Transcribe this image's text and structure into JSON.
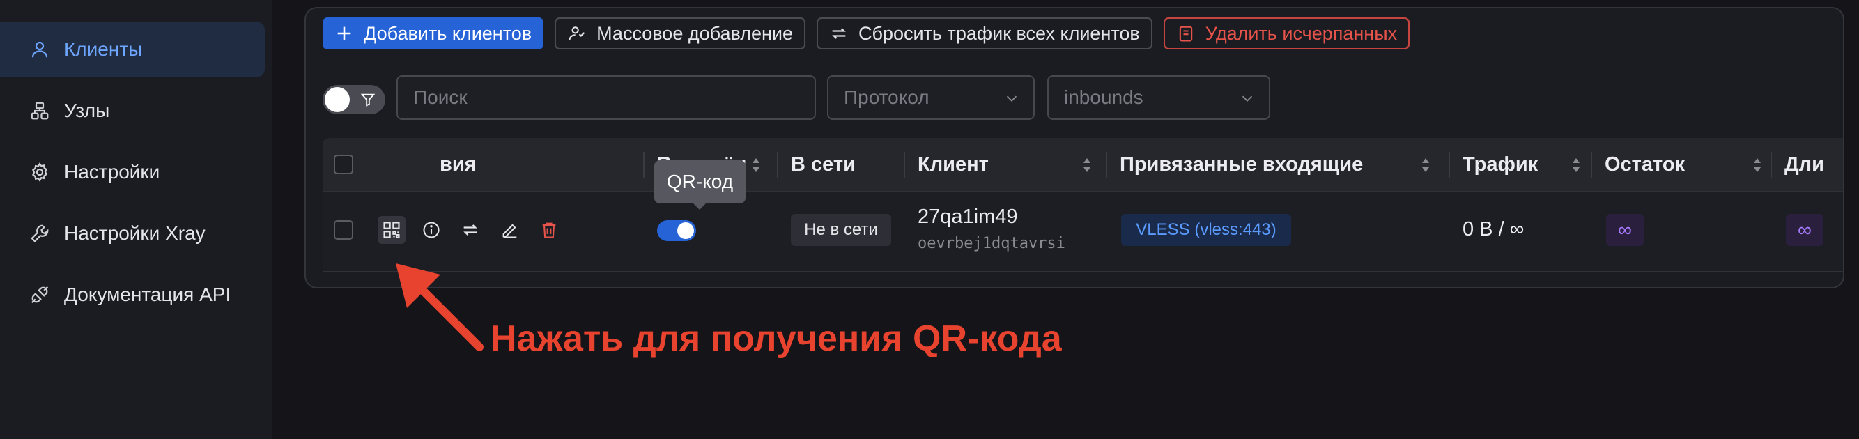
{
  "sidebar": {
    "items": [
      {
        "label": "Клиенты",
        "icon": "user-icon",
        "active": true
      },
      {
        "label": "Узлы",
        "icon": "nodes-icon"
      },
      {
        "label": "Настройки",
        "icon": "gear-icon"
      },
      {
        "label": "Настройки Xray",
        "icon": "wrench-icon"
      },
      {
        "label": "Документация API",
        "icon": "api-icon"
      }
    ]
  },
  "toolbar": {
    "add_clients": "Добавить клиентов",
    "bulk_add": "Массовое добавление",
    "reset_traffic": "Сбросить трафик всех клиентов",
    "delete_exhausted": "Удалить исчерпанных"
  },
  "filters": {
    "search_placeholder": "Поиск",
    "protocol_placeholder": "Протокол",
    "inbounds_placeholder": "inbounds"
  },
  "table": {
    "columns": {
      "actions": "вия",
      "enabled": "Включён",
      "online": "В сети",
      "client": "Клиент",
      "inbounds": "Привязанные входящие",
      "traffic": "Трафик",
      "remaining": "Остаток",
      "duration": "Дли"
    },
    "rows": [
      {
        "enabled": true,
        "online": "Не в сети",
        "client_name": "27qa1im49",
        "client_id": "oevrbej1dqtavrsi",
        "inbound_tag": "VLESS (vless:443)",
        "traffic": "0 B / ∞",
        "remaining": "∞",
        "duration": "∞"
      }
    ]
  },
  "tooltip": "QR-код",
  "annotation": "Нажать для получения QR-кода",
  "colors": {
    "accent": "#2563d6",
    "danger": "#e5534b",
    "annotation": "#e8432f",
    "active_nav_bg": "#1f2c42"
  }
}
